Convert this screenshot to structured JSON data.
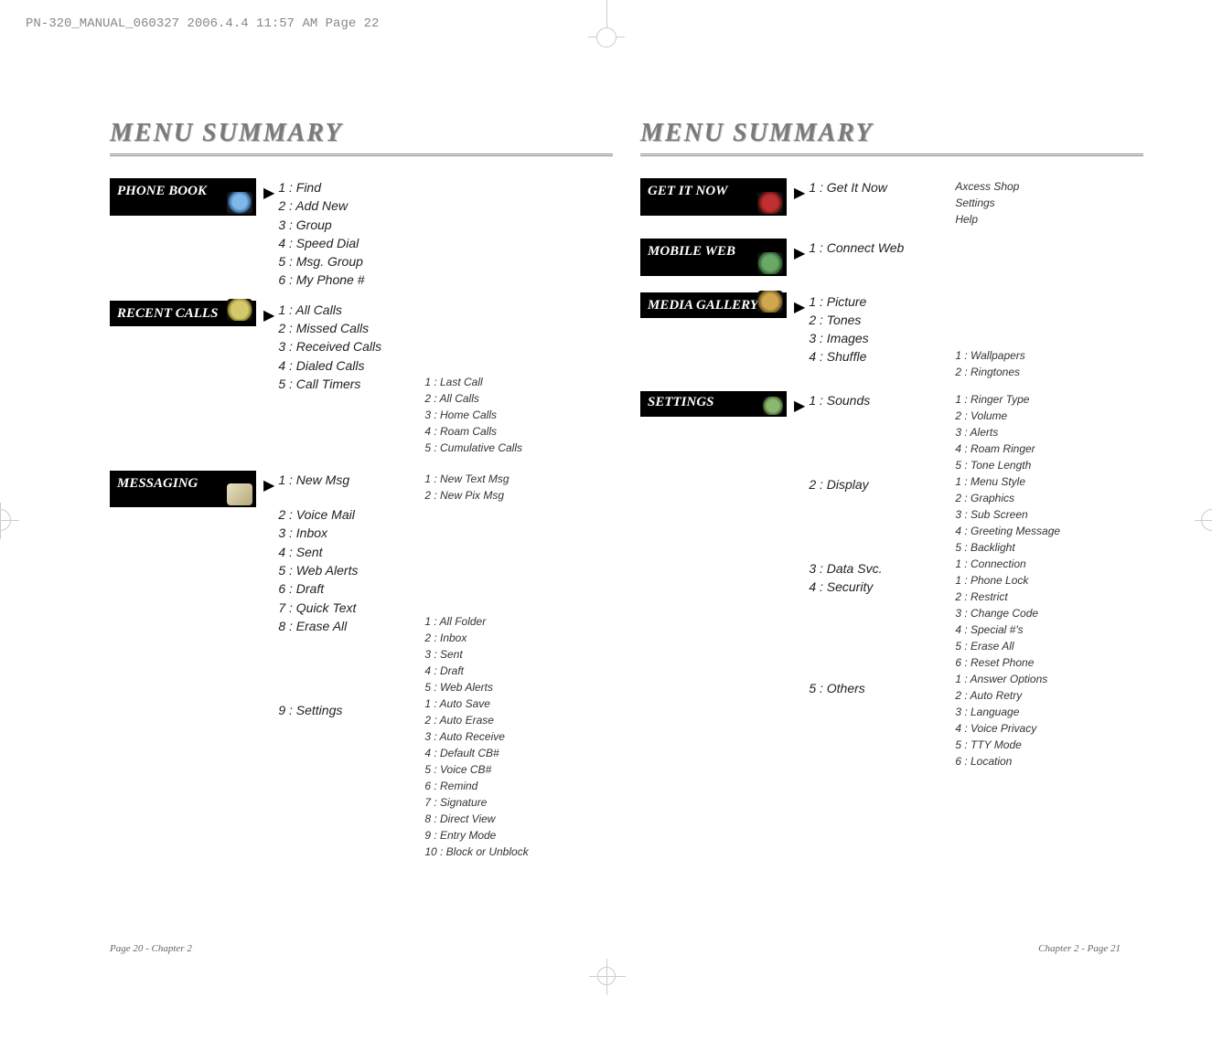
{
  "header_text": "PN-320_MANUAL_060327  2006.4.4  11:57 AM  Page 22",
  "title": "MENU SUMMARY",
  "footer_left": "Page 20 - Chapter 2",
  "footer_right": "Chapter 2 - Page 21",
  "phone_book": {
    "label": "PHONE BOOK",
    "items": [
      "1 : Find",
      "2 : Add New",
      "3 : Group",
      "4 : Speed Dial",
      "5 : Msg. Group",
      "6 : My Phone #"
    ]
  },
  "recent_calls": {
    "label": "RECENT CALLS",
    "items": [
      "1 : All Calls",
      "2 : Missed Calls",
      "3 : Received Calls",
      "4 : Dialed Calls",
      "5 : Call Timers"
    ],
    "sub5": [
      "1 : Last Call",
      "2 : All Calls",
      "3 : Home Calls",
      "4 : Roam Calls",
      "5 : Cumulative Calls"
    ]
  },
  "messaging": {
    "label": "MESSAGING",
    "items": [
      "1 : New Msg",
      "2 : Voice Mail",
      "3 : Inbox",
      "4 : Sent",
      "5 : Web Alerts",
      "6 : Draft",
      "7 : Quick Text",
      "8 : Erase All",
      "9 : Settings"
    ],
    "sub1": [
      "1 : New Text Msg",
      "2 : New Pix Msg"
    ],
    "sub8": [
      "1 : All Folder",
      "2 : Inbox",
      "3 : Sent",
      "4 : Draft",
      "5 : Web Alerts"
    ],
    "sub9": [
      "1 : Auto Save",
      "2 : Auto Erase",
      "3 : Auto Receive",
      "4 : Default CB#",
      "5 : Voice CB#",
      "6 : Remind",
      "7 : Signature",
      "8 : Direct View",
      "9 : Entry Mode",
      "10 : Block or Unblock"
    ]
  },
  "get_it_now": {
    "label": "GET IT NOW",
    "items": [
      "1 : Get It Now"
    ],
    "sub1": [
      "Axcess Shop",
      "Settings",
      "Help"
    ]
  },
  "mobile_web": {
    "label": "MOBILE WEB",
    "items": [
      "1 : Connect Web"
    ]
  },
  "media_gallery": {
    "label": "MEDIA GALLERY",
    "items": [
      "1 : Picture",
      "2 : Tones",
      "3 : Images",
      "4 : Shuffle"
    ],
    "sub4": [
      "1 : Wallpapers",
      "2 : Ringtones"
    ]
  },
  "settings": {
    "label": "SETTINGS",
    "items": [
      "1 : Sounds",
      "2 : Display",
      "3 : Data Svc.",
      "4 : Security",
      "5 : Others"
    ],
    "sub1": [
      "1 : Ringer Type",
      "2 : Volume",
      "3 : Alerts",
      "4 : Roam Ringer",
      "5 : Tone Length"
    ],
    "sub2": [
      "1 : Menu Style",
      "2 : Graphics",
      "3 : Sub Screen",
      "4 : Greeting Message",
      "5 : Backlight"
    ],
    "sub3": [
      "1 : Connection"
    ],
    "sub4": [
      "1 : Phone Lock",
      "2 : Restrict",
      "3 : Change Code",
      "4 : Special #'s",
      "5 : Erase All",
      "6 : Reset Phone"
    ],
    "sub5": [
      "1 : Answer Options",
      "2 : Auto Retry",
      "3 : Language",
      "4 : Voice Privacy",
      "5 : TTY Mode",
      "6 : Location"
    ]
  }
}
